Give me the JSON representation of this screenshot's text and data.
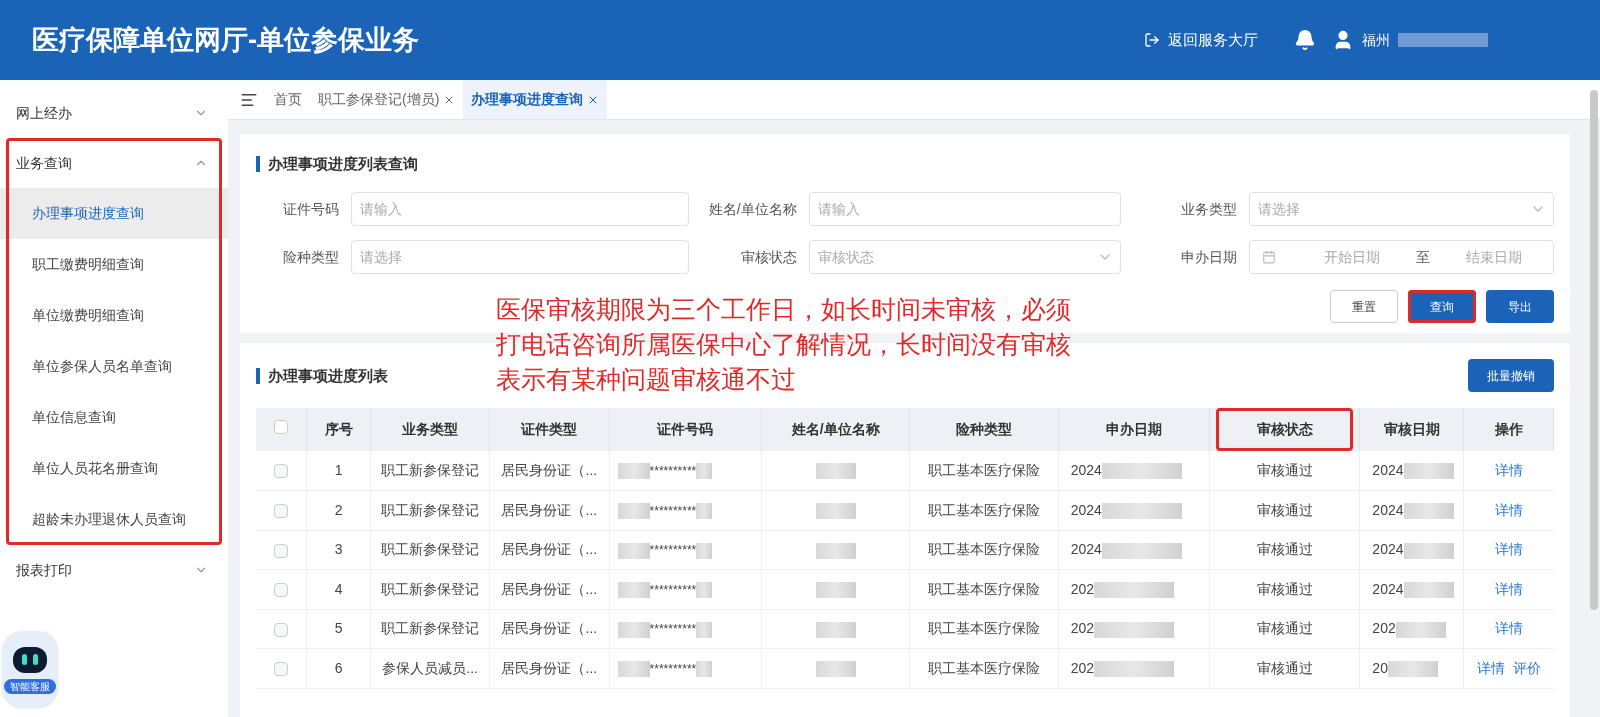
{
  "header": {
    "title": "医疗保障单位网厅-单位参保业务",
    "back_link": "返回服务大厅",
    "user": "福州"
  },
  "sidebar": [
    {
      "label": "网上经办",
      "expanded": false,
      "highlighted": false
    },
    {
      "label": "业务查询",
      "expanded": true,
      "highlighted": true,
      "children": [
        {
          "label": "办理事项进度查询",
          "selected": true
        },
        {
          "label": "职工缴费明细查询",
          "selected": false
        },
        {
          "label": "单位缴费明细查询",
          "selected": false
        },
        {
          "label": "单位参保人员名单查询",
          "selected": false
        },
        {
          "label": "单位信息查询",
          "selected": false
        },
        {
          "label": "单位人员花名册查询",
          "selected": false
        },
        {
          "label": "超龄未办理退休人员查询",
          "selected": false
        }
      ]
    },
    {
      "label": "报表打印",
      "expanded": false,
      "highlighted": false
    }
  ],
  "chat_widget": {
    "label": "智能客服"
  },
  "tabs": [
    {
      "label": "首页",
      "selected": false,
      "closable": false
    },
    {
      "label": "职工参保登记(增员)",
      "selected": false,
      "closable": true
    },
    {
      "label": "办理事项进度查询",
      "selected": true,
      "closable": true
    }
  ],
  "query_panel": {
    "title": "办理事项进度列表查询",
    "fields": [
      {
        "label": "证件号码",
        "kind": "input",
        "placeholder": "请输入"
      },
      {
        "label": "姓名/单位名称",
        "kind": "input",
        "placeholder": "请输入"
      },
      {
        "label": "业务类型",
        "kind": "select",
        "placeholder": "请选择"
      },
      {
        "label": "险种类型",
        "kind": "input",
        "placeholder": "请选择"
      },
      {
        "label": "审核状态",
        "kind": "select",
        "placeholder": "审核状态"
      },
      {
        "label": "申办日期",
        "kind": "daterange",
        "start": "开始日期",
        "separator": "至",
        "end": "结束日期"
      }
    ],
    "buttons": [
      {
        "label": "重置",
        "primary": false,
        "highlighted": false
      },
      {
        "label": "查询",
        "primary": true,
        "highlighted": true
      },
      {
        "label": "导出",
        "primary": true,
        "highlighted": false
      }
    ]
  },
  "annotation": "医保审核期限为三个工作日，如长时间未审核，必须打电话咨询所属医保中心了解情况，长时间没有审核表示有某种问题审核通不过",
  "list_panel": {
    "title": "办理事项进度列表",
    "batch_button": "批量撤销",
    "select_all_checked": false,
    "columns": [
      {
        "label": "序号",
        "highlighted": false
      },
      {
        "label": "业务类型",
        "highlighted": false
      },
      {
        "label": "证件类型",
        "highlighted": false
      },
      {
        "label": "证件号码",
        "highlighted": false
      },
      {
        "label": "姓名/单位名称",
        "highlighted": false
      },
      {
        "label": "险种类型",
        "highlighted": false
      },
      {
        "label": "申办日期",
        "highlighted": false
      },
      {
        "label": "审核状态",
        "highlighted": true
      },
      {
        "label": "审核日期",
        "highlighted": false
      },
      {
        "label": "操作",
        "highlighted": false
      }
    ],
    "rows": [
      {
        "checked": false,
        "seq": "1",
        "business_type": "职工新参保登记",
        "id_type": "居民身份证（...",
        "id_number": "**********",
        "insurance": "职工基本医疗保险",
        "apply_date": "2024",
        "status": "审核通过",
        "review_date": "2024",
        "actions": [
          "详情"
        ]
      },
      {
        "checked": false,
        "seq": "2",
        "business_type": "职工新参保登记",
        "id_type": "居民身份证（...",
        "id_number": "**********",
        "insurance": "职工基本医疗保险",
        "apply_date": "2024",
        "status": "审核通过",
        "review_date": "2024",
        "actions": [
          "详情"
        ]
      },
      {
        "checked": false,
        "seq": "3",
        "business_type": "职工新参保登记",
        "id_type": "居民身份证（...",
        "id_number": "**********",
        "insurance": "职工基本医疗保险",
        "apply_date": "2024",
        "status": "审核通过",
        "review_date": "2024",
        "actions": [
          "详情"
        ]
      },
      {
        "checked": false,
        "seq": "4",
        "business_type": "职工新参保登记",
        "id_type": "居民身份证（...",
        "id_number": "**********",
        "insurance": "职工基本医疗保险",
        "apply_date": "202",
        "status": "审核通过",
        "review_date": "2024",
        "actions": [
          "详情"
        ]
      },
      {
        "checked": false,
        "seq": "5",
        "business_type": "职工新参保登记",
        "id_type": "居民身份证（...",
        "id_number": "**********",
        "insurance": "职工基本医疗保险",
        "apply_date": "202",
        "status": "审核通过",
        "review_date": "202",
        "actions": [
          "详情"
        ]
      },
      {
        "checked": false,
        "seq": "6",
        "business_type": "参保人员减员...",
        "id_type": "居民身份证（...",
        "id_number": "**********",
        "insurance": "职工基本医疗保险",
        "apply_date": "202",
        "status": "审核通过",
        "review_date": "20",
        "actions": [
          "详情",
          "评价"
        ]
      }
    ]
  }
}
